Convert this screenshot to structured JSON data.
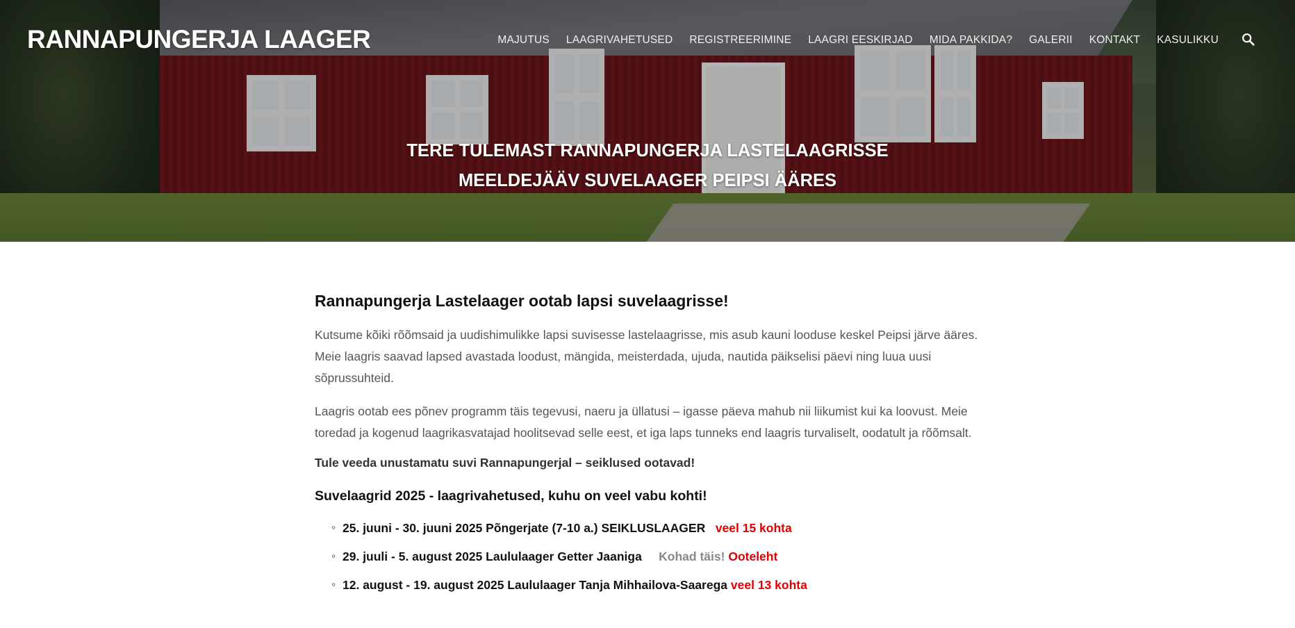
{
  "header": {
    "site_title": "RANNAPUNGERJA LAAGER",
    "nav": [
      "MAJUTUS",
      "LAAGRIVAHETUSED",
      "REGISTREERIMINE",
      "LAAGRI EESKIRJAD",
      "MIDA PAKKIDA?",
      "GALERII",
      "KONTAKT",
      "KASULIKKU"
    ],
    "search_icon": "search-icon"
  },
  "hero": {
    "line1": "TERE TULEMAST RANNAPUNGERJA LASTELAAGRISSE",
    "line2": "MEELDEJÄÄV SUVELAAGER PEIPSI ÄÄRES"
  },
  "main": {
    "heading": "Rannapungerja Lastelaager ootab lapsi suvelaagrisse!",
    "para1": "Kutsume kõiki rõõmsaid ja uudishimulikke lapsi suvisesse lastelaagrisse, mis asub kauni looduse keskel Peipsi järve ääres. Meie laagris saavad lapsed avastada loodust, mängida, meisterdada, ujuda, nautida päikselisi päevi ning luua uusi sõprussuhteid.",
    "para2": "Laagris ootab ees põnev programm täis tegevusi, naeru ja üllatusi – igasse päeva mahub nii liikumist kui ka loovust. Meie toredad ja kogenud laagrikasvatajad hoolitsevad selle eest, et iga laps tunneks end laagris turvaliselt, oodatult ja rõõmsalt.",
    "bold_line": "Tule veeda unustamatu suvi Rannapungerjal – seiklused ootavad!",
    "subheading": "Suvelaagrid 2025 - laagrivahetused, kuhu on veel vabu kohti!",
    "camps": [
      {
        "text": "25. juuni - 30. juuni 2025 Põngerjate (7-10 a.) SEIKLUSLAAGER",
        "status_grey": "",
        "status_red": "veel 15 kohta"
      },
      {
        "text": "29. juuli - 5. august 2025 Laululaager Getter Jaaniga",
        "status_grey": "Kohad täis!",
        "status_red": "Ooteleht"
      },
      {
        "text": "12. august - 19. august 2025 Laululaager Tanja Mihhailova-Saarega",
        "status_grey": "",
        "status_red": "veel 13 kohta"
      }
    ]
  }
}
